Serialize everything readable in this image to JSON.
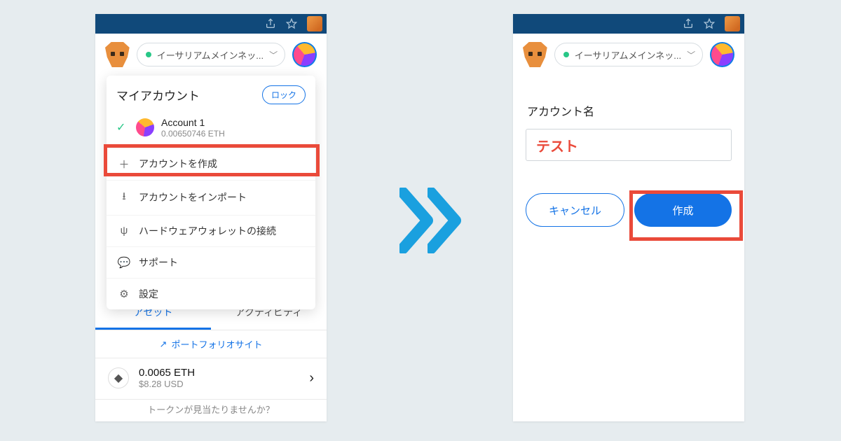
{
  "colors": {
    "accent": "#1473e6",
    "highlight": "#ea4a3a",
    "titlebar": "#10497a"
  },
  "left": {
    "network": "イーサリアムメインネッ...",
    "menu_title": "マイアカウント",
    "lock_label": "ロック",
    "account": {
      "name": "Account 1",
      "balance": "0.00650746 ETH"
    },
    "items": {
      "create": "アカウントを作成",
      "import": "アカウントをインポート",
      "hardware": "ハードウェアウォレットの接続",
      "support": "サポート",
      "settings": "設定"
    },
    "tabs": {
      "assets": "アセット",
      "activity": "アクティビティ"
    },
    "portfolio_link": "ポートフォリオサイト",
    "asset": {
      "amount": "0.0065 ETH",
      "fiat": "$8.28 USD"
    },
    "token_question": "トークンが見当たりませんか？"
  },
  "right": {
    "network": "イーサリアムメインネッ...",
    "field_label": "アカウント名",
    "field_value": "テスト",
    "cancel": "キャンセル",
    "create": "作成"
  }
}
